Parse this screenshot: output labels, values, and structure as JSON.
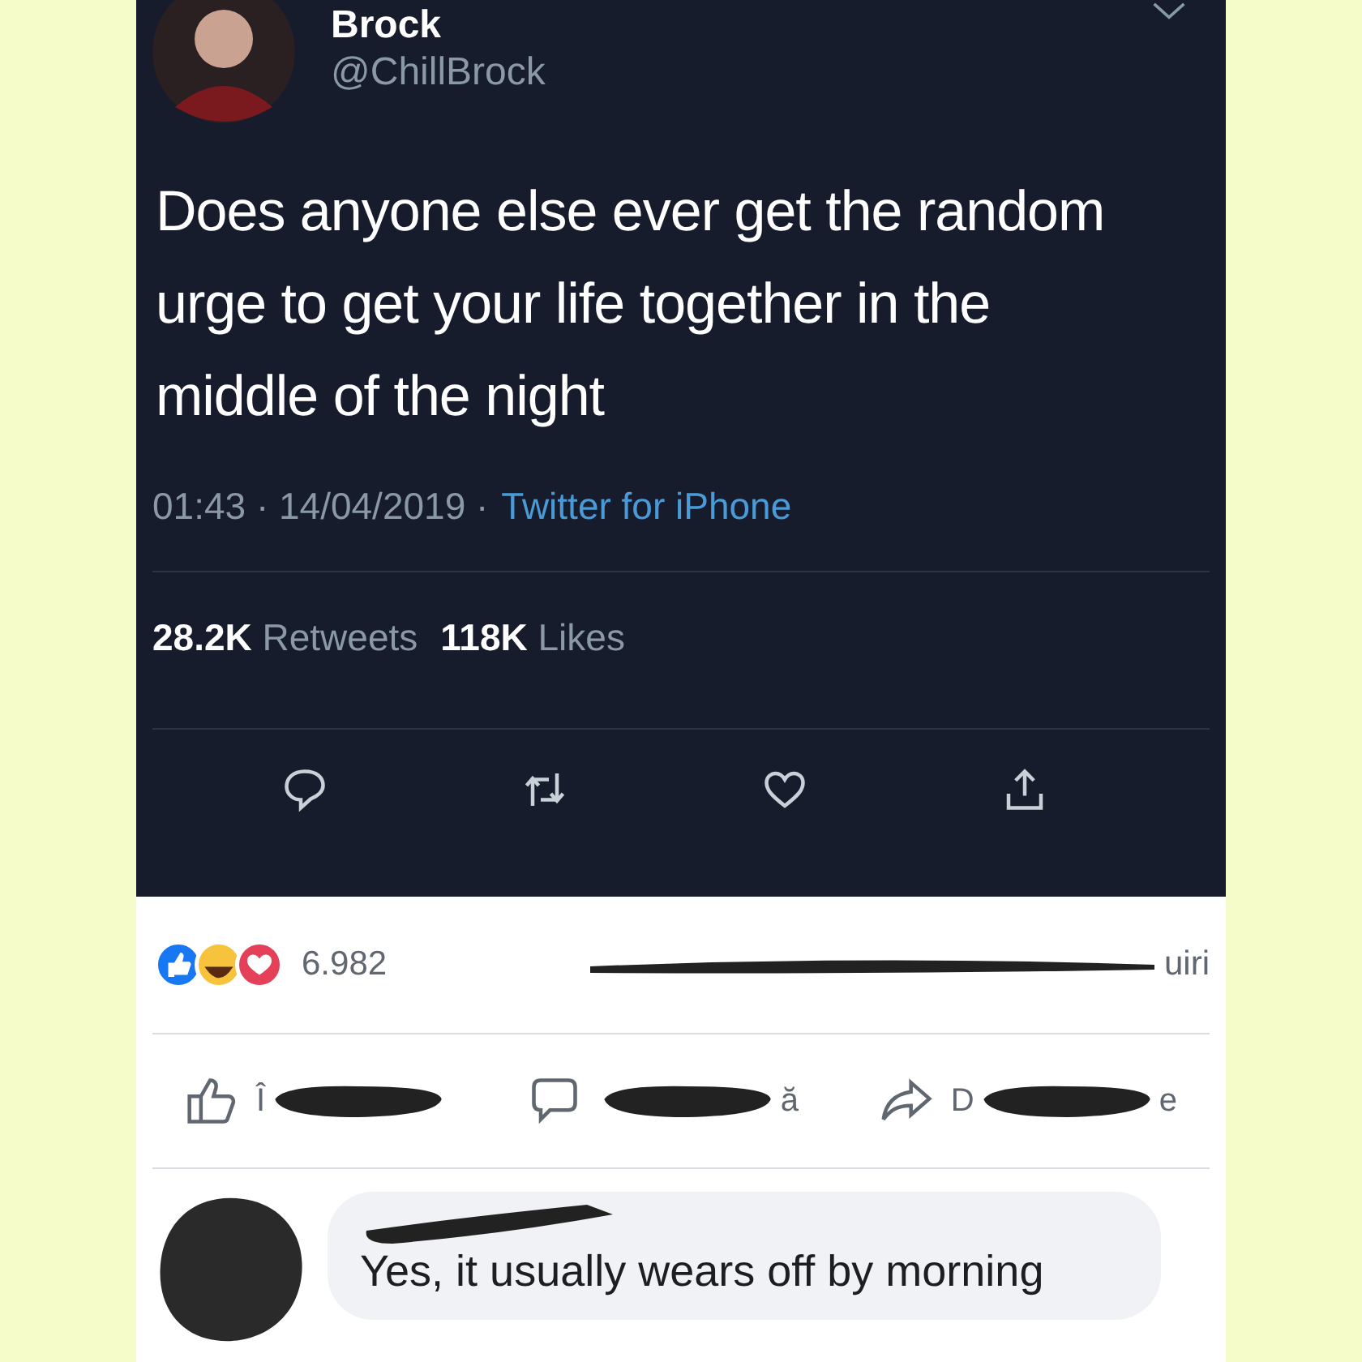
{
  "tweet": {
    "name": "Brock",
    "handle": "@ChillBrock",
    "text": "Does anyone else ever get the random urge to get your life together in the middle of the night",
    "timestamp": "01:43 · 14/04/2019 ·",
    "source": "Twitter for iPhone",
    "retweets": "28.2K",
    "retweets_label": "Retweets",
    "likes": "118K",
    "likes_label": "Likes"
  },
  "facebook": {
    "reaction_count": "6.982",
    "counts_fragment": "uiri",
    "actions": [
      {
        "kind": "like",
        "before": "Î"
      },
      {
        "kind": "comment",
        "after": "ă"
      },
      {
        "kind": "share",
        "before": "D",
        "after": "e"
      }
    ],
    "comment": {
      "text": "Yes, it usually wears off by morning"
    }
  }
}
